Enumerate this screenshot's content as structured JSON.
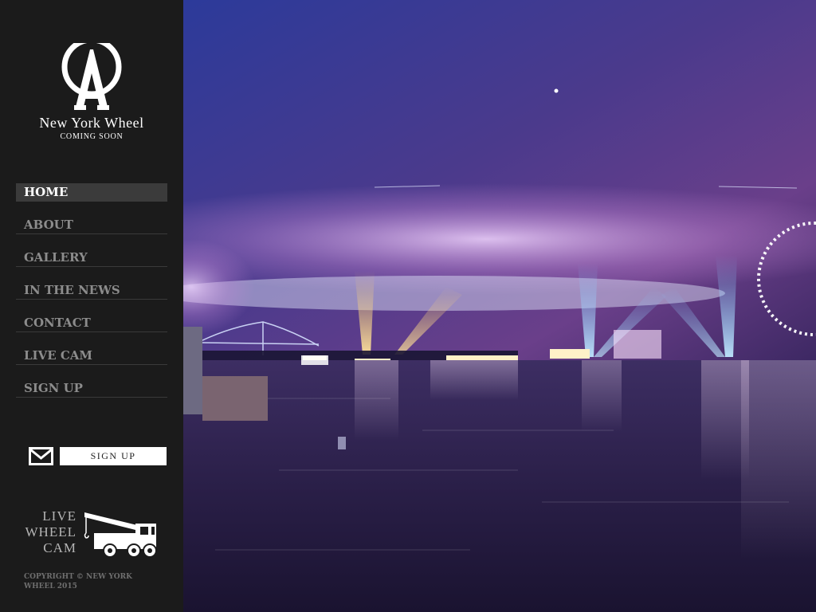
{
  "brand": {
    "name": "New York Wheel",
    "tagline": "Coming Soon",
    "icon": "ny-wheel-logo-icon"
  },
  "nav": {
    "items": [
      {
        "label": "HOME",
        "active": true
      },
      {
        "label": "ABOUT",
        "active": false
      },
      {
        "label": "GALLERY",
        "active": false
      },
      {
        "label": "IN THE NEWS",
        "active": false
      },
      {
        "label": "CONTACT",
        "active": false
      },
      {
        "label": "LIVE CAM",
        "active": false
      },
      {
        "label": "SIGN UP",
        "active": false
      }
    ]
  },
  "signup": {
    "icon": "envelope-icon",
    "button_label": "SIGN UP"
  },
  "live_cam": {
    "lines": [
      "LIVE",
      "WHEEL",
      "CAM"
    ],
    "icon": "crane-truck-icon"
  },
  "footer": {
    "copyright": "COPYRIGHT © NEW YORK WHEEL 2015"
  },
  "hero": {
    "description_icon": "night-harbor-photo",
    "colors": {
      "sky_top": "#2b2f7e",
      "sky_mid": "#5a3f8e",
      "glow": "#d9a8e8",
      "water": "#2a1f45"
    }
  },
  "colors": {
    "sidebar_bg": "#1b1b1b",
    "nav_text": "#8c8c8c",
    "nav_active_bg": "#3b3b3b",
    "nav_active_text": "#ffffff"
  }
}
